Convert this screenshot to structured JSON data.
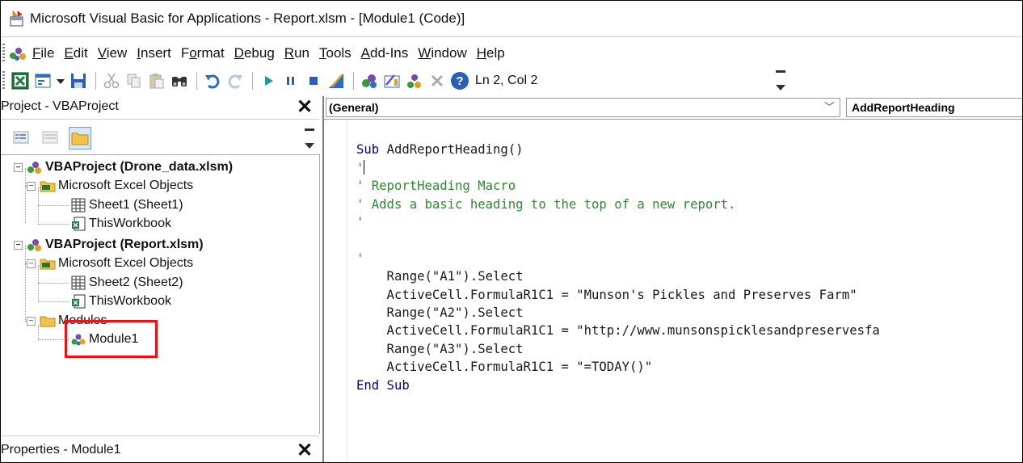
{
  "window": {
    "title": "Microsoft Visual Basic for Applications - Report.xlsm - [Module1 (Code)]",
    "app_icon": "vba-app-icon"
  },
  "menu": {
    "items": [
      "File",
      "Edit",
      "View",
      "Insert",
      "Format",
      "Debug",
      "Run",
      "Tools",
      "Add-Ins",
      "Window",
      "Help"
    ],
    "underline_chars": [
      "F",
      "E",
      "V",
      "I",
      "o",
      "D",
      "R",
      "T",
      "A",
      "W",
      "H"
    ]
  },
  "toolbar": {
    "status": "Ln 2, Col 2",
    "icons": [
      "view-excel-icon",
      "insert-userform-icon",
      "dropdown-arrow-icon",
      "save-icon",
      "cut-icon",
      "copy-icon",
      "paste-icon",
      "find-icon",
      "undo-icon",
      "redo-icon",
      "run-icon",
      "break-icon",
      "reset-icon",
      "design-mode-icon",
      "project-explorer-icon",
      "properties-window-icon",
      "object-browser-icon",
      "toolbox-icon",
      "help-icon"
    ]
  },
  "project_pane": {
    "title": "Project - VBAProject",
    "close_label": "✕",
    "tree": [
      {
        "label": "VBAProject (Drone_data.xlsm)",
        "level": 0,
        "bold": true,
        "expander": "−"
      },
      {
        "label": "Microsoft Excel Objects",
        "level": 1,
        "bold": false,
        "expander": "−"
      },
      {
        "label": "Sheet1 (Sheet1)",
        "level": 2,
        "bold": false,
        "expander": ""
      },
      {
        "label": "ThisWorkbook",
        "level": 2,
        "bold": false,
        "expander": ""
      },
      {
        "label": "VBAProject (Report.xlsm)",
        "level": 0,
        "bold": true,
        "expander": "−"
      },
      {
        "label": "Microsoft Excel Objects",
        "level": 1,
        "bold": false,
        "expander": "−"
      },
      {
        "label": "Sheet2 (Sheet2)",
        "level": 2,
        "bold": false,
        "expander": ""
      },
      {
        "label": "ThisWorkbook",
        "level": 2,
        "bold": false,
        "expander": ""
      },
      {
        "label": "Modules",
        "level": 1,
        "bold": false,
        "expander": "−"
      },
      {
        "label": "Module1",
        "level": 2,
        "bold": false,
        "expander": "",
        "highlighted": true
      }
    ]
  },
  "properties_pane": {
    "title": "Properties - Module1",
    "close_label": "✕"
  },
  "code_window": {
    "object_combo": "(General)",
    "procedure_combo": "AddReportHeading",
    "lines": [
      "Sub AddReportHeading()",
      "'",
      "' ReportHeading Macro",
      "' Adds a basic heading to the top of a new report.",
      "'",
      "",
      "'",
      "    Range(\"A1\").Select",
      "    ActiveCell.FormulaR1C1 = \"Munson's Pickles and Preserves Farm\"",
      "    Range(\"A2\").Select",
      "    ActiveCell.FormulaR1C1 = \"http://www.munsonspicklesandpreservesfa",
      "    Range(\"A3\").Select",
      "    ActiveCell.FormulaR1C1 = \"=TODAY()\"",
      "End Sub"
    ]
  },
  "colors": {
    "keyword": "#00008b",
    "comment": "#2e8b2e",
    "highlight_box": "#e11111"
  }
}
